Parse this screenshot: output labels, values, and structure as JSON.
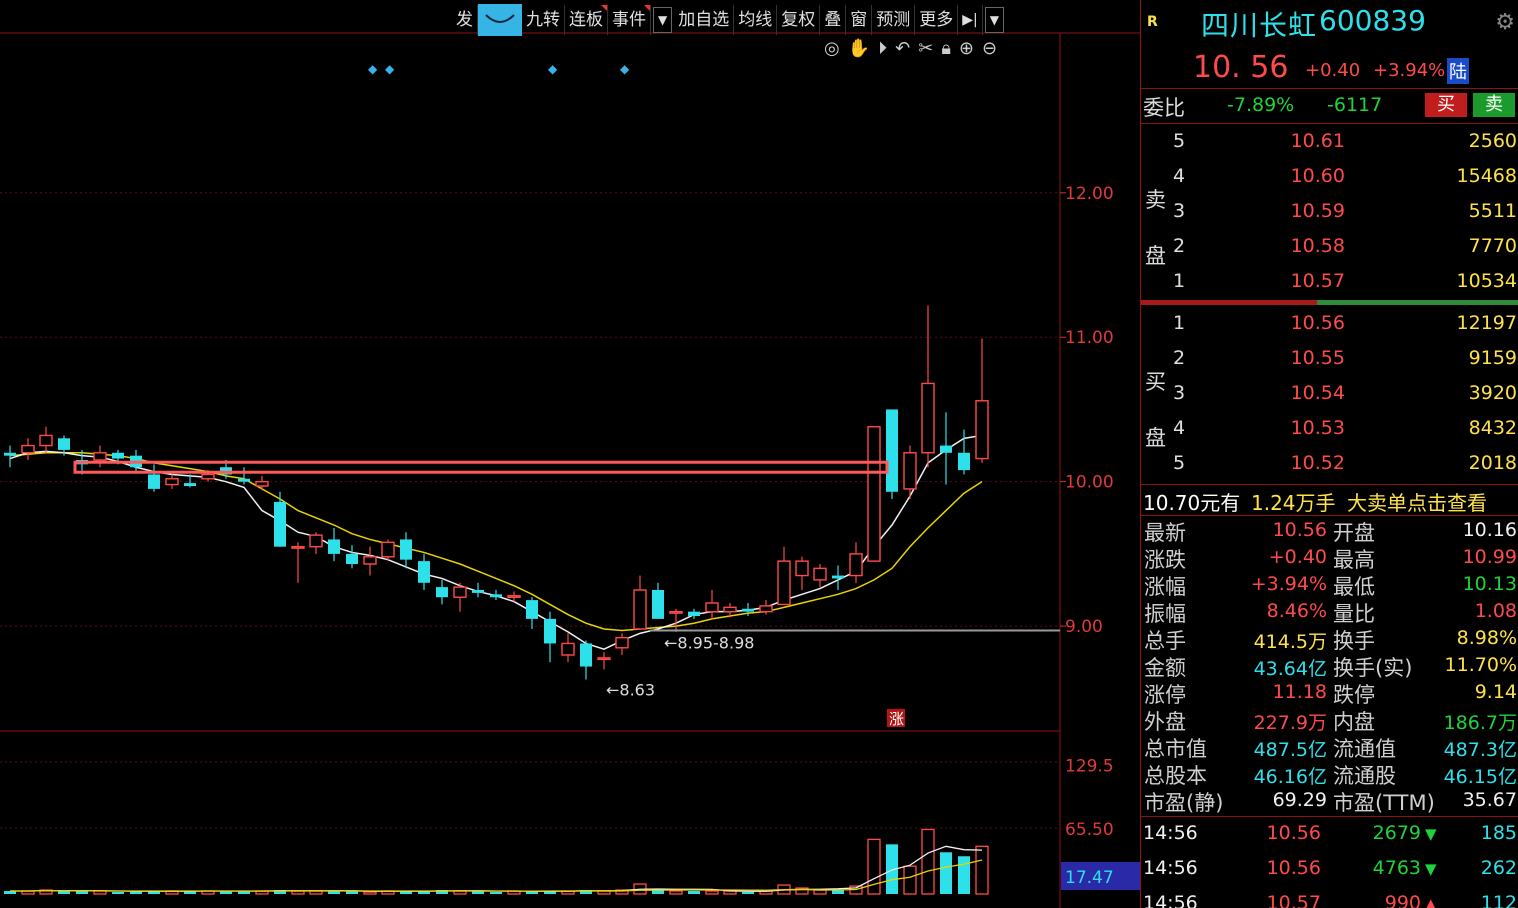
{
  "toolbar": {
    "items": [
      {
        "label": "发",
        "active": false
      },
      {
        "label": "",
        "active": true,
        "icon": "smile-icon"
      },
      {
        "label": "九转",
        "active": false
      },
      {
        "label": "连板",
        "active": false
      },
      {
        "label": "事件",
        "active": false
      }
    ],
    "items2": [
      {
        "label": "加自选"
      },
      {
        "label": "均线"
      },
      {
        "label": "复权"
      },
      {
        "label": "叠"
      },
      {
        "label": "窗"
      },
      {
        "label": "预测"
      },
      {
        "label": "更多"
      }
    ]
  },
  "chart_data": {
    "type": "candlestick",
    "price_axis": {
      "ticks": [
        "12.00",
        "11.00",
        "10.00",
        "9.00"
      ],
      "values": [
        12,
        11,
        10,
        9
      ],
      "range": [
        8.35,
        12.85
      ]
    },
    "volume_axis": {
      "ticks": [
        "129.5",
        "65.50"
      ],
      "current": "17.47",
      "range": [
        0,
        150
      ]
    },
    "annotations": {
      "low": "8.63",
      "range_label": "8.95-8.98",
      "limit_up_mark": "涨",
      "support_level": 8.97,
      "resistance_level": 10.1
    },
    "candles": [
      [
        10.2,
        10.25,
        10.1,
        10.18
      ],
      [
        10.2,
        10.3,
        10.15,
        10.25
      ],
      [
        10.25,
        10.38,
        10.2,
        10.32
      ],
      [
        10.3,
        10.32,
        10.18,
        10.22
      ],
      [
        10.15,
        10.22,
        10.05,
        10.12
      ],
      [
        10.15,
        10.25,
        10.1,
        10.2
      ],
      [
        10.2,
        10.22,
        10.12,
        10.16
      ],
      [
        10.18,
        10.22,
        10.06,
        10.1
      ],
      [
        10.05,
        10.12,
        9.93,
        9.95
      ],
      [
        9.98,
        10.05,
        9.95,
        10.02
      ],
      [
        9.99,
        10.05,
        9.96,
        9.97
      ],
      [
        10.02,
        10.08,
        10.0,
        10.05
      ],
      [
        10.1,
        10.15,
        10.02,
        10.05
      ],
      [
        10.02,
        10.1,
        9.98,
        10.0
      ],
      [
        9.97,
        10.04,
        9.94,
        10.0
      ],
      [
        9.86,
        9.93,
        9.55,
        9.55
      ],
      [
        9.55,
        9.58,
        9.3,
        9.55
      ],
      [
        9.55,
        9.65,
        9.5,
        9.63
      ],
      [
        9.6,
        9.68,
        9.45,
        9.5
      ],
      [
        9.5,
        9.56,
        9.4,
        9.43
      ],
      [
        9.43,
        9.55,
        9.35,
        9.48
      ],
      [
        9.48,
        9.6,
        9.45,
        9.58
      ],
      [
        9.6,
        9.65,
        9.4,
        9.46
      ],
      [
        9.45,
        9.5,
        9.25,
        9.3
      ],
      [
        9.27,
        9.32,
        9.15,
        9.2
      ],
      [
        9.2,
        9.3,
        9.1,
        9.27
      ],
      [
        9.25,
        9.3,
        9.2,
        9.23
      ],
      [
        9.22,
        9.25,
        9.18,
        9.2
      ],
      [
        9.21,
        9.24,
        9.17,
        9.21
      ],
      [
        9.18,
        9.2,
        8.98,
        9.05
      ],
      [
        9.05,
        9.1,
        8.75,
        8.88
      ],
      [
        8.8,
        8.95,
        8.75,
        8.88
      ],
      [
        8.88,
        8.9,
        8.63,
        8.72
      ],
      [
        8.78,
        8.82,
        8.7,
        8.78
      ],
      [
        8.85,
        8.95,
        8.8,
        8.92
      ],
      [
        8.98,
        9.35,
        8.98,
        9.25
      ],
      [
        9.25,
        9.3,
        9.05,
        9.05
      ],
      [
        9.1,
        9.12,
        8.96,
        9.1
      ],
      [
        9.1,
        9.12,
        9.05,
        9.07
      ],
      [
        9.1,
        9.25,
        9.05,
        9.16
      ],
      [
        9.1,
        9.16,
        9.06,
        9.13
      ],
      [
        9.12,
        9.16,
        9.07,
        9.1
      ],
      [
        9.1,
        9.18,
        9.08,
        9.14
      ],
      [
        9.15,
        9.55,
        9.15,
        9.45
      ],
      [
        9.35,
        9.48,
        9.25,
        9.45
      ],
      [
        9.32,
        9.43,
        9.27,
        9.4
      ],
      [
        9.35,
        9.42,
        9.25,
        9.33
      ],
      [
        9.35,
        9.58,
        9.3,
        9.5
      ],
      [
        9.45,
        10.38,
        9.45,
        10.38
      ],
      [
        10.5,
        10.5,
        9.88,
        9.93
      ],
      [
        9.95,
        10.25,
        9.88,
        10.2
      ],
      [
        10.2,
        11.22,
        10.1,
        10.68
      ],
      [
        10.25,
        10.48,
        9.98,
        10.2
      ],
      [
        10.2,
        10.36,
        10.05,
        10.08
      ],
      [
        10.16,
        10.99,
        10.13,
        10.56
      ]
    ],
    "ma5_y": [
      10.16,
      10.2,
      10.21,
      10.2,
      10.18,
      10.17,
      10.14,
      10.1,
      10.07,
      10.05,
      10.04,
      10.03,
      10.0,
      9.96,
      9.8,
      9.73,
      9.65,
      9.62,
      9.55,
      9.51,
      9.49,
      9.46,
      9.41,
      9.36,
      9.33,
      9.28,
      9.24,
      9.21,
      9.17,
      9.1,
      9.03,
      8.96,
      8.88,
      8.84,
      8.9,
      8.95,
      8.98,
      9.02,
      9.08,
      9.1,
      9.1,
      9.11,
      9.13,
      9.18,
      9.22,
      9.26,
      9.32,
      9.38,
      9.55,
      9.7,
      9.9,
      10.13,
      10.22,
      10.3,
      10.32
    ],
    "ma10_y": [
      10.18,
      10.19,
      10.2,
      10.2,
      10.2,
      10.19,
      10.18,
      10.16,
      10.13,
      10.11,
      10.09,
      10.07,
      10.04,
      10.02,
      9.95,
      9.88,
      9.8,
      9.75,
      9.7,
      9.64,
      9.6,
      9.57,
      9.54,
      9.51,
      9.47,
      9.43,
      9.38,
      9.33,
      9.28,
      9.22,
      9.15,
      9.08,
      9.02,
      8.98,
      8.97,
      8.98,
      8.99,
      9.0,
      9.02,
      9.05,
      9.07,
      9.09,
      9.1,
      9.13,
      9.16,
      9.19,
      9.22,
      9.26,
      9.32,
      9.4,
      9.55,
      9.68,
      9.8,
      9.92,
      10.0
    ],
    "volumes": [
      3,
      3,
      4,
      3,
      3,
      3,
      2,
      3,
      3,
      3,
      3,
      3,
      3,
      3,
      3,
      4,
      3,
      3,
      3,
      3,
      2,
      3,
      3,
      3,
      4,
      3,
      3,
      2,
      3,
      3,
      3,
      3,
      4,
      3,
      4,
      10,
      4,
      3,
      3,
      3,
      3,
      2,
      3,
      9,
      6,
      4,
      4,
      8,
      55,
      50,
      28,
      65,
      42,
      38,
      48
    ]
  },
  "quote": {
    "r_badge": "R",
    "name": "四川长虹",
    "code": "600839",
    "price": "10. 56",
    "change": "+0.40",
    "pct": "+3.94%",
    "market": "陆"
  },
  "ratio": {
    "label": "委比",
    "pct": "-7.89%",
    "diff": "-6117",
    "buy": "买",
    "sell": "卖"
  },
  "asks": {
    "label1": "卖",
    "label2": "盘",
    "rows": [
      {
        "lvl": "5",
        "price": "10.61",
        "vol": "2560"
      },
      {
        "lvl": "4",
        "price": "10.60",
        "vol": "15468"
      },
      {
        "lvl": "3",
        "price": "10.59",
        "vol": "5511"
      },
      {
        "lvl": "2",
        "price": "10.58",
        "vol": "7770"
      },
      {
        "lvl": "1",
        "price": "10.57",
        "vol": "10534"
      }
    ]
  },
  "bids": {
    "label1": "买",
    "label2": "盘",
    "rows": [
      {
        "lvl": "1",
        "price": "10.56",
        "vol": "12197"
      },
      {
        "lvl": "2",
        "price": "10.55",
        "vol": "9159"
      },
      {
        "lvl": "3",
        "price": "10.54",
        "vol": "3920"
      },
      {
        "lvl": "4",
        "price": "10.53",
        "vol": "8432"
      },
      {
        "lvl": "5",
        "price": "10.52",
        "vol": "2018"
      }
    ]
  },
  "big_order": {
    "price": "10.70元有",
    "qty": "1.24万手",
    "text": "大卖单点击查看"
  },
  "stats": [
    {
      "k1": "最新",
      "v1": "10.56",
      "c1": "up",
      "k2": "开盘",
      "v2": "10.16",
      "c2": "white"
    },
    {
      "k1": "涨跌",
      "v1": "+0.40",
      "c1": "up",
      "k2": "最高",
      "v2": "10.99",
      "c2": "up"
    },
    {
      "k1": "涨幅",
      "v1": "+3.94%",
      "c1": "up",
      "k2": "最低",
      "v2": "10.13",
      "c2": "down"
    },
    {
      "k1": "振幅",
      "v1": "8.46%",
      "c1": "up",
      "k2": "量比",
      "v2": "1.08",
      "c2": "up"
    },
    {
      "k1": "总手",
      "v1": "414.5万",
      "c1": "yel",
      "k2": "换手",
      "v2": "8.98%",
      "c2": "yel"
    },
    {
      "k1": "金额",
      "v1": "43.64亿",
      "c1": "cyan",
      "k2": "换手(实)",
      "v2": "11.70%",
      "c2": "yel"
    },
    {
      "k1": "涨停",
      "v1": "11.18",
      "c1": "up",
      "k2": "跌停",
      "v2": "9.14",
      "c2": "yel"
    },
    {
      "k1": "外盘",
      "v1": "227.9万",
      "c1": "up",
      "k2": "内盘",
      "v2": "186.7万",
      "c2": "down"
    },
    {
      "k1": "总市值",
      "v1": "487.5亿",
      "c1": "cyan",
      "k2": "流通值",
      "v2": "487.3亿",
      "c2": "cyan"
    },
    {
      "k1": "总股本",
      "v1": "46.16亿",
      "c1": "cyan",
      "k2": "流通股",
      "v2": "46.15亿",
      "c2": "cyan"
    },
    {
      "k1": "市盈(静)",
      "v1": "69.29",
      "c1": "white",
      "k2": "市盈(TTM)",
      "v2": "35.67",
      "c2": "white"
    }
  ],
  "ticks": [
    {
      "time": "14:56",
      "price": "10.56",
      "vol": "2679",
      "dir": "down",
      "num": "185"
    },
    {
      "time": "14:56",
      "price": "10.56",
      "vol": "4763",
      "dir": "down",
      "num": "262"
    },
    {
      "time": "14:56",
      "price": "10.57",
      "vol": "990",
      "dir": "up",
      "num": "112"
    }
  ]
}
